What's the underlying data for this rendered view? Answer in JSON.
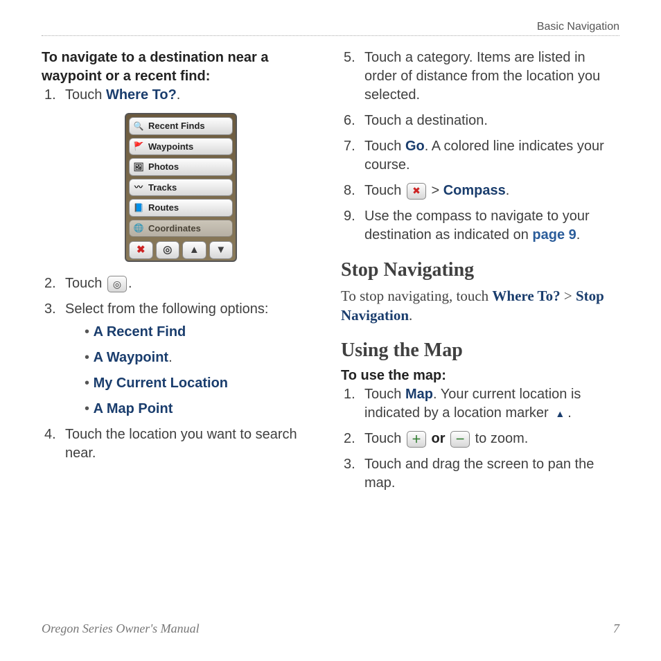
{
  "header": "Basic Navigation",
  "left": {
    "heading": "To navigate to a destination near a waypoint or a recent find:",
    "step1_pre": "Touch ",
    "step1_link": "Where To?",
    "step1_post": ".",
    "device": {
      "items": [
        "Recent Finds",
        "Waypoints",
        "Photos",
        "Tracks",
        "Routes",
        "Coordinates"
      ]
    },
    "step2_pre": "Touch ",
    "step2_post": ".",
    "step3": " Select from the following options:",
    "options": [
      "A Recent Find",
      "A Waypoint",
      "My Current Location",
      "A Map Point"
    ],
    "opt1_post": "",
    "opt2_post": ".",
    "step4": "Touch the location you want to search near."
  },
  "right": {
    "step5": "Touch a category. Items are listed in order of distance from the location you selected.",
    "step6": "Touch a destination.",
    "step7_pre": "Touch ",
    "step7_link": "Go",
    "step7_post": ". A colored line indicates your course.",
    "step8_pre": "Touch ",
    "step8_mid": " > ",
    "step8_link": "Compass",
    "step8_post": ".",
    "step9_pre": "Use the compass to navigate to your destination as indicated on ",
    "step9_link": "page 9",
    "step9_post": ".",
    "h_stop": "Stop Navigating",
    "stop_pre": "To stop navigating, touch ",
    "stop_l1": "Where To?",
    "stop_mid": " > ",
    "stop_l2": "Stop Navigation",
    "stop_post": ".",
    "h_map": "Using the Map",
    "map_head": "To use the map:",
    "m1_pre": "Touch ",
    "m1_link": "Map",
    "m1_mid": ". Your current location is indicated by a location marker ",
    "m1_post": ".",
    "m2_pre": "Touch ",
    "m2_or": " or ",
    "m2_post": "  to zoom.",
    "m3": "Touch and drag the screen to pan the map."
  },
  "footer": {
    "left": "Oregon Series Owner's Manual",
    "right": "7"
  }
}
